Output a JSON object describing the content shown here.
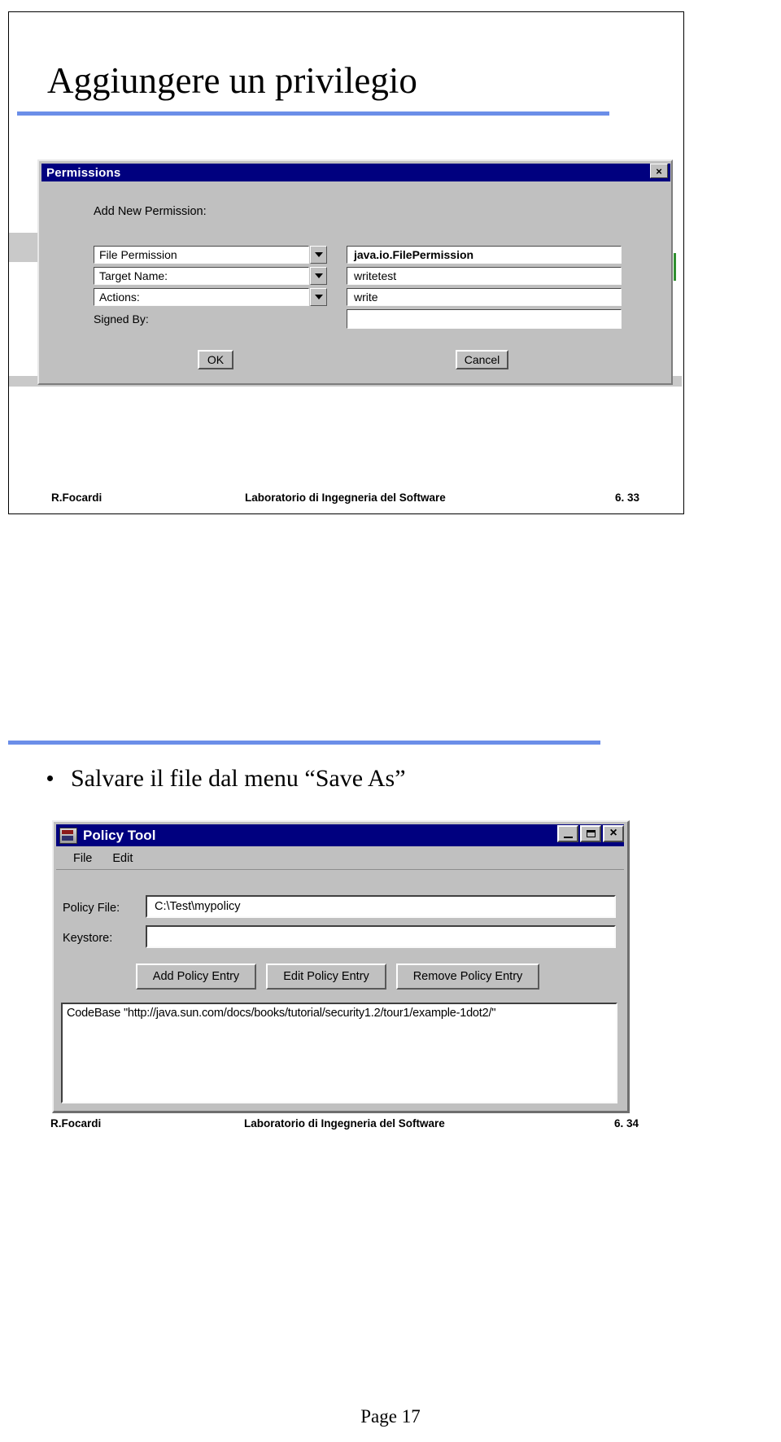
{
  "document": {
    "page_label": "Page 17"
  },
  "slide1": {
    "title": "Aggiungere un privilegio",
    "footer": {
      "author": "R.Focardi",
      "course": "Laboratorio di Ingegneria del Software",
      "number": "6. 33"
    },
    "permissions_dialog": {
      "window_title": "Permissions",
      "close_icon": "×",
      "section_label": "Add New Permission:",
      "rows": [
        {
          "name": "permission-type",
          "combo_value": "File Permission",
          "text_value": "java.io.FilePermission",
          "bold": true
        },
        {
          "name": "target-name",
          "combo_value": "Target Name:",
          "text_value": "writetest",
          "bold": false
        },
        {
          "name": "actions",
          "combo_value": "Actions:",
          "text_value": "write",
          "bold": false
        }
      ],
      "signed_by_label": "Signed By:",
      "signed_by_value": "",
      "ok_label": "OK",
      "cancel_label": "Cancel"
    }
  },
  "slide2": {
    "bullet": "Salvare il file dal menu “Save As”",
    "footer": {
      "author": "R.Focardi",
      "course": "Laboratorio di Ingegneria del Software",
      "number": "6. 34"
    },
    "policy_tool": {
      "window_title": "Policy Tool",
      "app_icon": "policy-tool-icon",
      "minimize_icon": "_",
      "maximize_icon": "□",
      "close_icon": "×",
      "menus": [
        "File",
        "Edit"
      ],
      "fields": [
        {
          "label": "Policy File:",
          "value": "C:\\Test\\mypolicy"
        },
        {
          "label": "Keystore:",
          "value": ""
        }
      ],
      "buttons": [
        "Add Policy Entry",
        "Edit Policy Entry",
        "Remove Policy Entry"
      ],
      "entries": [
        "CodeBase \"http://java.sun.com/docs/books/tutorial/security1.2/tour1/example-1dot2/\""
      ]
    }
  },
  "theme": {
    "accent_rule": "#6b8ee8",
    "titlebar": "#00007f",
    "chrome_face": "#c0c0c0"
  }
}
